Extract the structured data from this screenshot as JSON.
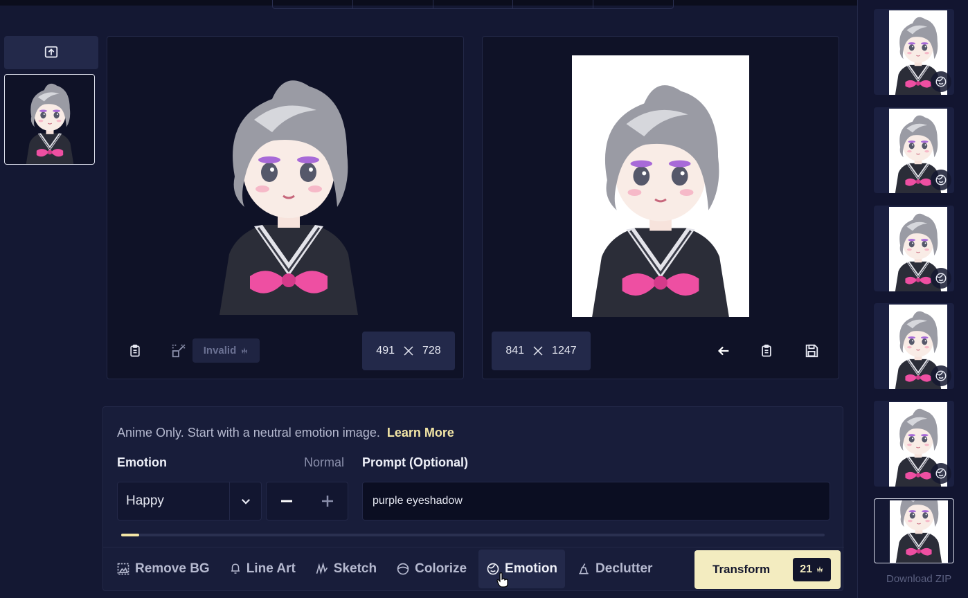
{
  "source": {
    "width": "491",
    "height": "728",
    "status_label": "Invalid"
  },
  "result": {
    "width": "841",
    "height": "1247"
  },
  "controls": {
    "hint_text": "Anime Only. Start with a neutral emotion image.",
    "learn_more": "Learn More",
    "emotion_label": "Emotion",
    "intensity_label": "Normal",
    "prompt_label": "Prompt (Optional)",
    "emotion_value": "Happy",
    "prompt_value": "purple eyeshadow",
    "slider_value": 0.026
  },
  "tools": {
    "remove_bg": "Remove BG",
    "line_art": "Line Art",
    "sketch": "Sketch",
    "colorize": "Colorize",
    "emotion": "Emotion",
    "declutter": "Declutter"
  },
  "transform": {
    "label": "Transform",
    "cost": "21"
  },
  "sidebar": {
    "download_label": "Download ZIP"
  },
  "colors": {
    "background": "#141833",
    "accent": "#f3ecc0",
    "panel": "#0f1227"
  }
}
